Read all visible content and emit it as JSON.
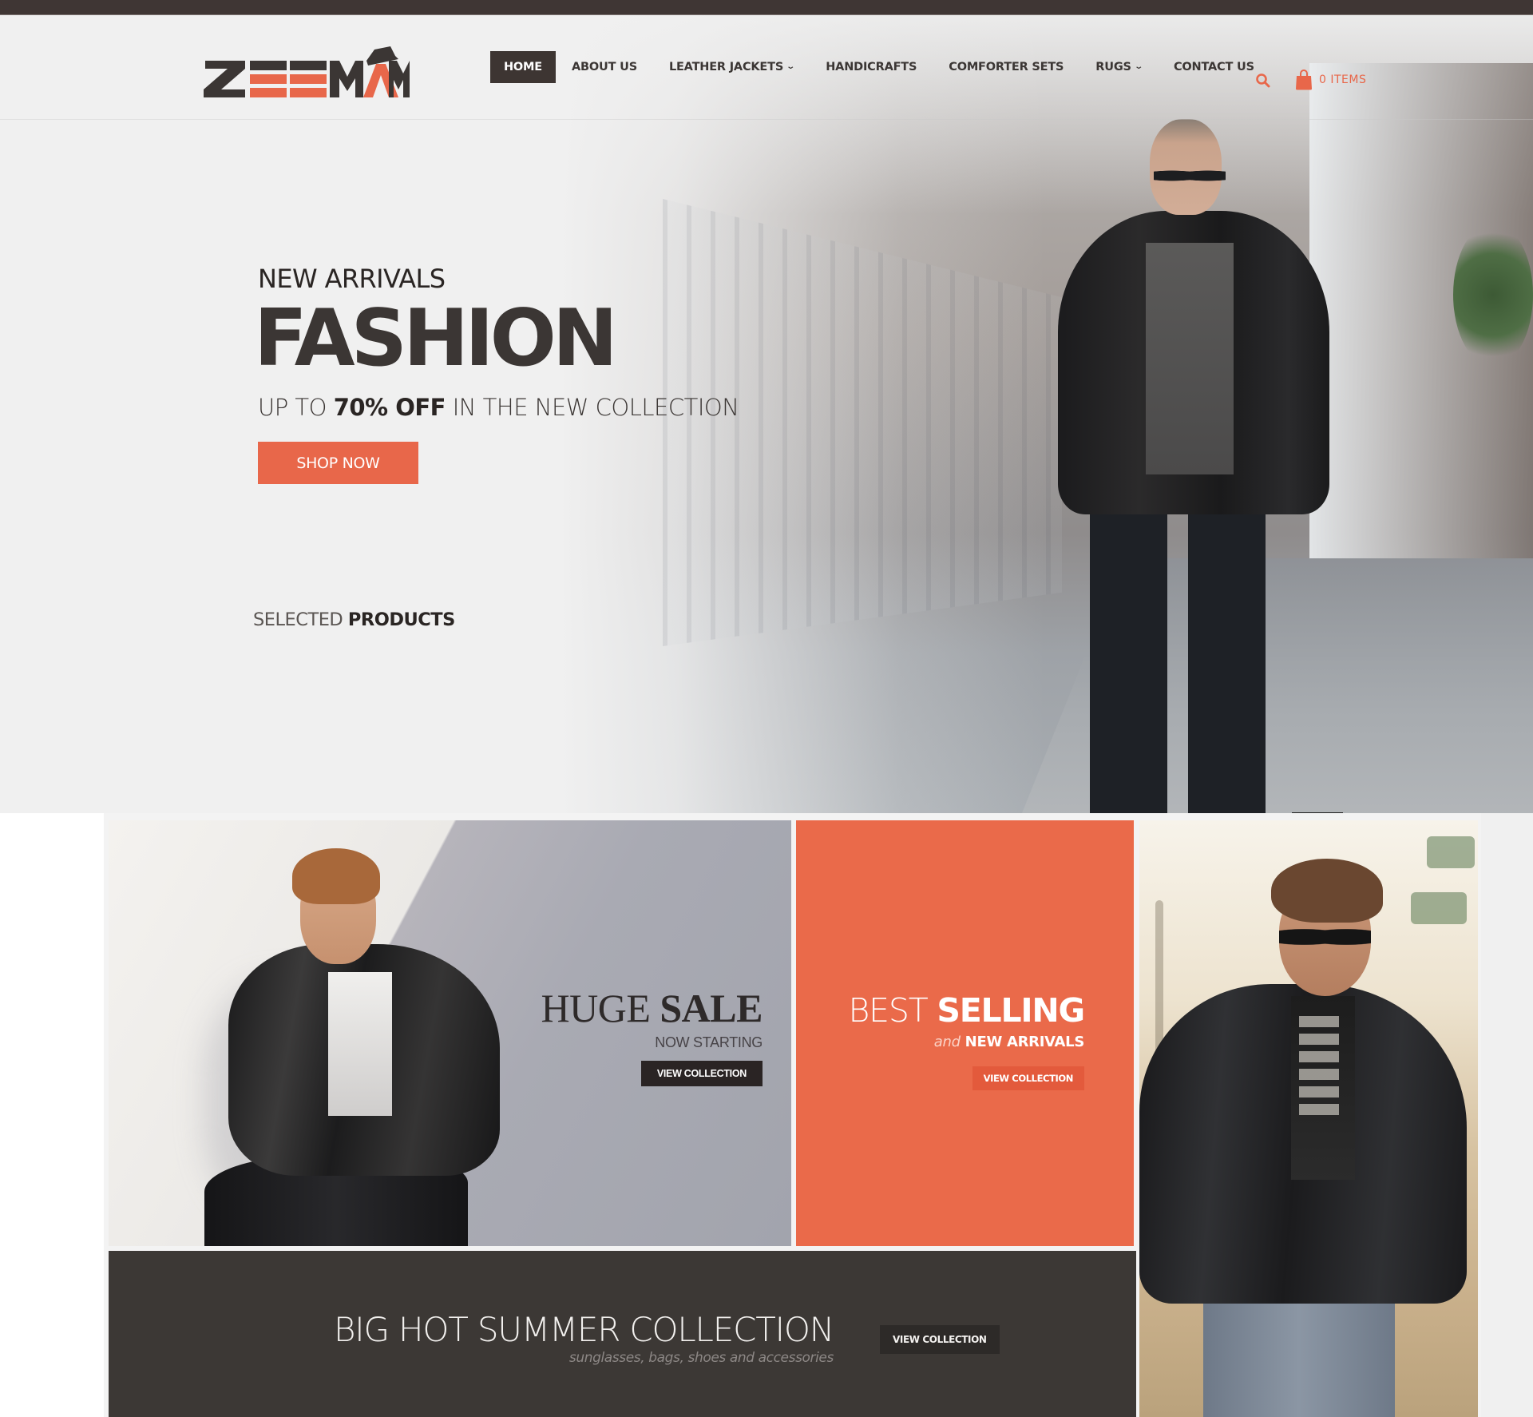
{
  "brand": {
    "name": "ZEEMAM",
    "colors": {
      "accent": "#e8674a",
      "dark": "#3b3634",
      "background": "#f0f0f0"
    }
  },
  "nav": {
    "items": [
      {
        "label": "HOME",
        "active": true,
        "has_dropdown": false
      },
      {
        "label": "ABOUT US",
        "active": false,
        "has_dropdown": false
      },
      {
        "label": "LEATHER JACKETS",
        "active": false,
        "has_dropdown": true
      },
      {
        "label": "HANDICRAFTS",
        "active": false,
        "has_dropdown": false
      },
      {
        "label": "COMFORTER SETS",
        "active": false,
        "has_dropdown": false
      },
      {
        "label": "RUGS",
        "active": false,
        "has_dropdown": true
      },
      {
        "label": "CONTACT US",
        "active": false,
        "has_dropdown": false
      }
    ],
    "dropdown_icon": "chevron-down-icon",
    "search_icon": "search-icon",
    "cart": {
      "icon": "shopping-bag-icon",
      "label": "0 ITEMS",
      "count": 0
    }
  },
  "hero": {
    "subtitle": "NEW ARRIVALS",
    "title": "FASHION",
    "promo_prefix": "UP TO ",
    "promo_highlight": "70% OFF",
    "promo_suffix": " IN THE NEW COLLECTION",
    "cta": "SHOP NOW",
    "section_prefix": "SELECTED ",
    "section_highlight": "PRODUCTS"
  },
  "promos": {
    "huge_sale": {
      "title_light": "HUGE ",
      "title_bold": "SALE",
      "subtitle": "NOW STARTING",
      "button": "VIEW COLLECTION"
    },
    "best_selling": {
      "title_light": "BEST ",
      "title_bold": "SELLING",
      "sub_italic": "and",
      "sub_bold": " NEW ARRIVALS",
      "button": "VIEW COLLECTION"
    },
    "summer": {
      "title": "BIG HOT SUMMER COLLECTION",
      "subtitle": "sunglasses, bags, shoes and accessories",
      "button": "VIEW COLLECTION"
    }
  }
}
